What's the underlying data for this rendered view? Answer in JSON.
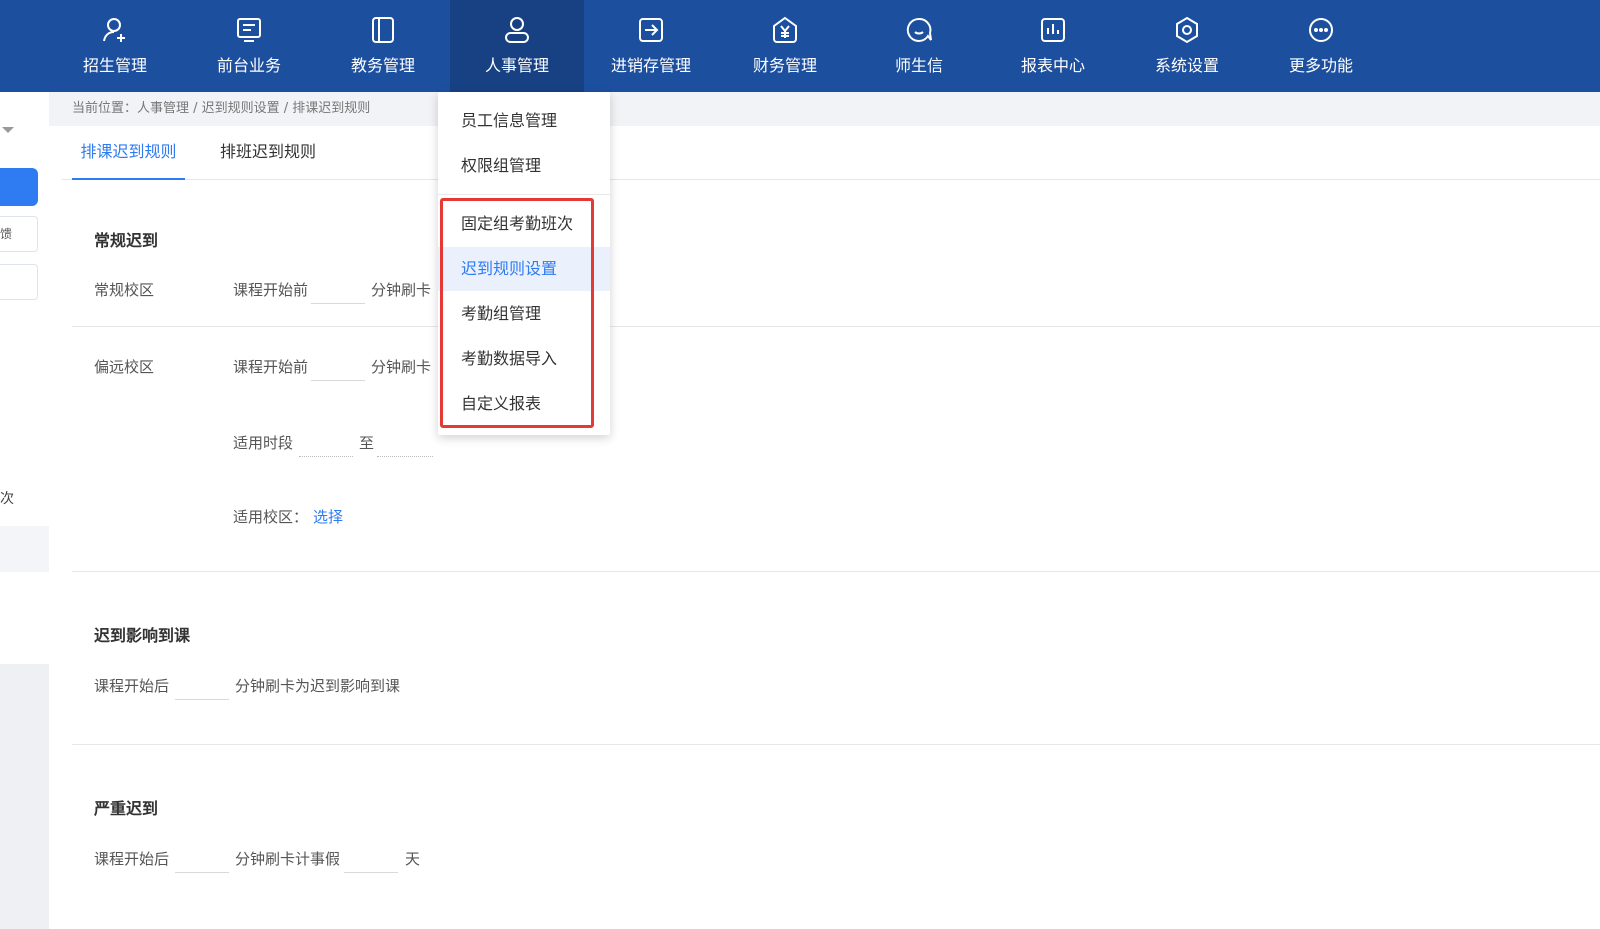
{
  "nav": {
    "items": [
      {
        "label": "招生管理",
        "icon": "user-add-icon"
      },
      {
        "label": "前台业务",
        "icon": "monitor-icon"
      },
      {
        "label": "教务管理",
        "icon": "book-icon"
      },
      {
        "label": "人事管理",
        "icon": "user-icon"
      },
      {
        "label": "进销存管理",
        "icon": "arrow-box-icon"
      },
      {
        "label": "财务管理",
        "icon": "yen-house-icon"
      },
      {
        "label": "师生信",
        "icon": "chat-icon"
      },
      {
        "label": "报表中心",
        "icon": "bar-chart-icon"
      },
      {
        "label": "系统设置",
        "icon": "gear-icon"
      },
      {
        "label": "更多功能",
        "icon": "more-icon"
      }
    ],
    "active_index": 3
  },
  "sidebar": {
    "feedback_label": "馈",
    "cut_text": "次"
  },
  "breadcrumb": "当前位置：人事管理 / 迟到规则设置 / 排课迟到规则",
  "tabs": [
    {
      "label": "排课迟到规则",
      "active": true
    },
    {
      "label": "排班迟到规则",
      "active": false
    }
  ],
  "regular": {
    "title": "常规迟到",
    "campus_label": "常规校区",
    "before_label": "课程开始前",
    "minutes_label": "分钟刷卡"
  },
  "remote": {
    "campus_label": "偏远校区",
    "before_label": "课程开始前",
    "minutes_label": "分钟刷卡",
    "period_label": "适用时段",
    "to_label": "至",
    "campus_select_label": "适用校区：",
    "select_link": "选择"
  },
  "affect": {
    "title": "迟到影响到课",
    "after_label": "课程开始后",
    "desc": "分钟刷卡为迟到影响到课"
  },
  "severe": {
    "title": "严重迟到",
    "after_label": "课程开始后",
    "desc": "分钟刷卡计事假",
    "day_label": "天"
  },
  "dropdown": {
    "items": [
      {
        "label": "员工信息管理"
      },
      {
        "label": "权限组管理"
      },
      {
        "label": "固定组考勤班次"
      },
      {
        "label": "迟到规则设置",
        "selected": true
      },
      {
        "label": "考勤组管理"
      },
      {
        "label": "考勤数据导入"
      },
      {
        "label": "自定义报表"
      }
    ]
  },
  "colors": {
    "topbar": "#1d4f9f",
    "accent": "#2f7bf2",
    "highlight": "#e53935"
  }
}
